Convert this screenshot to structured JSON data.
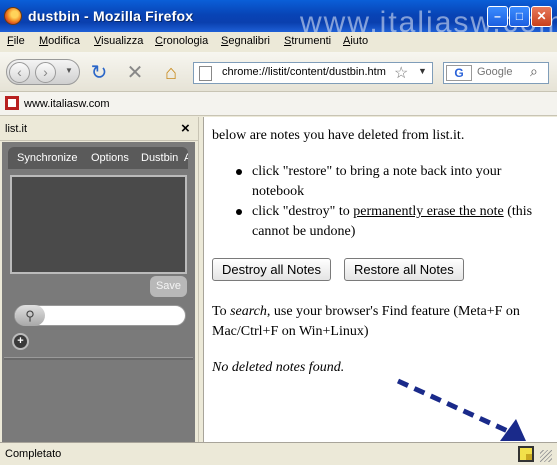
{
  "window": {
    "title": "dustbin - Mozilla Firefox",
    "watermark": "www.italiasw.com"
  },
  "menu": [
    "File",
    "Modifica",
    "Visualizza",
    "Cronologia",
    "Segnalibri",
    "Strumenti",
    "Aiuto"
  ],
  "nav": {
    "url": "chrome://listit/content/dustbin.htm",
    "search_placeholder": "Google",
    "search_engine_letter": "G"
  },
  "bookmarks": {
    "item": "www.italiasw.com"
  },
  "sidebar": {
    "title": "list.it",
    "tabs": [
      "Synchronize",
      "Options",
      "Dustbin",
      "A"
    ],
    "save_label": "Save",
    "plus_label": "+"
  },
  "content": {
    "intro": "below are notes you have deleted from list.it.",
    "bullet1": "click \"restore\" to bring a note back into your notebook",
    "bullet2_a": "click \"destroy\" to ",
    "bullet2_link": "permanently erase the note",
    "bullet2_b": " (this cannot be undone)",
    "destroy_label": "Destroy all Notes",
    "restore_label": "Restore all Notes",
    "search_a": "To ",
    "search_em": "search",
    "search_b": ", use your browser's Find feature (Meta+F on Mac/Ctrl+F on Win+Linux)",
    "empty": "No deleted notes found."
  },
  "status": {
    "text": "Completato"
  }
}
